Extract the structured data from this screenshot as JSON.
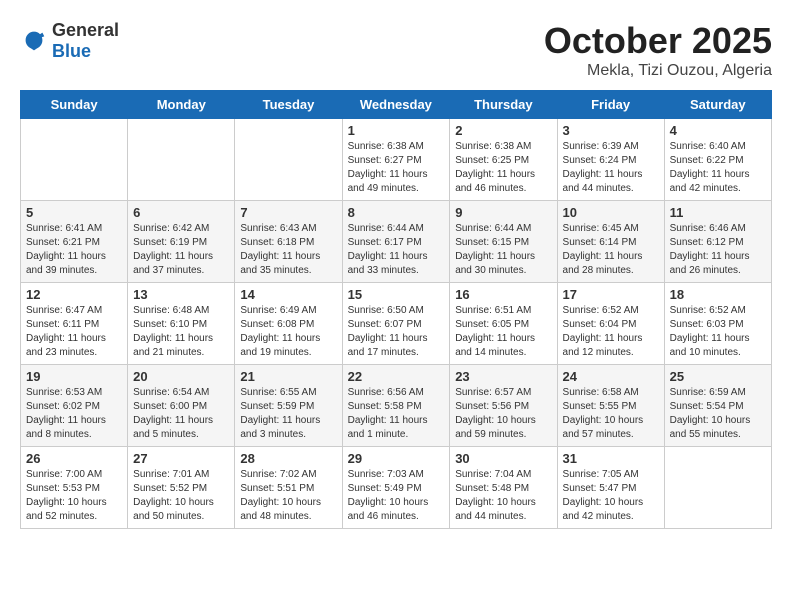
{
  "header": {
    "logo_general": "General",
    "logo_blue": "Blue",
    "month_title": "October 2025",
    "location": "Mekla, Tizi Ouzou, Algeria"
  },
  "weekdays": [
    "Sunday",
    "Monday",
    "Tuesday",
    "Wednesday",
    "Thursday",
    "Friday",
    "Saturday"
  ],
  "weeks": [
    [
      {
        "day": "",
        "detail": ""
      },
      {
        "day": "",
        "detail": ""
      },
      {
        "day": "",
        "detail": ""
      },
      {
        "day": "1",
        "detail": "Sunrise: 6:38 AM\nSunset: 6:27 PM\nDaylight: 11 hours\nand 49 minutes."
      },
      {
        "day": "2",
        "detail": "Sunrise: 6:38 AM\nSunset: 6:25 PM\nDaylight: 11 hours\nand 46 minutes."
      },
      {
        "day": "3",
        "detail": "Sunrise: 6:39 AM\nSunset: 6:24 PM\nDaylight: 11 hours\nand 44 minutes."
      },
      {
        "day": "4",
        "detail": "Sunrise: 6:40 AM\nSunset: 6:22 PM\nDaylight: 11 hours\nand 42 minutes."
      }
    ],
    [
      {
        "day": "5",
        "detail": "Sunrise: 6:41 AM\nSunset: 6:21 PM\nDaylight: 11 hours\nand 39 minutes."
      },
      {
        "day": "6",
        "detail": "Sunrise: 6:42 AM\nSunset: 6:19 PM\nDaylight: 11 hours\nand 37 minutes."
      },
      {
        "day": "7",
        "detail": "Sunrise: 6:43 AM\nSunset: 6:18 PM\nDaylight: 11 hours\nand 35 minutes."
      },
      {
        "day": "8",
        "detail": "Sunrise: 6:44 AM\nSunset: 6:17 PM\nDaylight: 11 hours\nand 33 minutes."
      },
      {
        "day": "9",
        "detail": "Sunrise: 6:44 AM\nSunset: 6:15 PM\nDaylight: 11 hours\nand 30 minutes."
      },
      {
        "day": "10",
        "detail": "Sunrise: 6:45 AM\nSunset: 6:14 PM\nDaylight: 11 hours\nand 28 minutes."
      },
      {
        "day": "11",
        "detail": "Sunrise: 6:46 AM\nSunset: 6:12 PM\nDaylight: 11 hours\nand 26 minutes."
      }
    ],
    [
      {
        "day": "12",
        "detail": "Sunrise: 6:47 AM\nSunset: 6:11 PM\nDaylight: 11 hours\nand 23 minutes."
      },
      {
        "day": "13",
        "detail": "Sunrise: 6:48 AM\nSunset: 6:10 PM\nDaylight: 11 hours\nand 21 minutes."
      },
      {
        "day": "14",
        "detail": "Sunrise: 6:49 AM\nSunset: 6:08 PM\nDaylight: 11 hours\nand 19 minutes."
      },
      {
        "day": "15",
        "detail": "Sunrise: 6:50 AM\nSunset: 6:07 PM\nDaylight: 11 hours\nand 17 minutes."
      },
      {
        "day": "16",
        "detail": "Sunrise: 6:51 AM\nSunset: 6:05 PM\nDaylight: 11 hours\nand 14 minutes."
      },
      {
        "day": "17",
        "detail": "Sunrise: 6:52 AM\nSunset: 6:04 PM\nDaylight: 11 hours\nand 12 minutes."
      },
      {
        "day": "18",
        "detail": "Sunrise: 6:52 AM\nSunset: 6:03 PM\nDaylight: 11 hours\nand 10 minutes."
      }
    ],
    [
      {
        "day": "19",
        "detail": "Sunrise: 6:53 AM\nSunset: 6:02 PM\nDaylight: 11 hours\nand 8 minutes."
      },
      {
        "day": "20",
        "detail": "Sunrise: 6:54 AM\nSunset: 6:00 PM\nDaylight: 11 hours\nand 5 minutes."
      },
      {
        "day": "21",
        "detail": "Sunrise: 6:55 AM\nSunset: 5:59 PM\nDaylight: 11 hours\nand 3 minutes."
      },
      {
        "day": "22",
        "detail": "Sunrise: 6:56 AM\nSunset: 5:58 PM\nDaylight: 11 hours\nand 1 minute."
      },
      {
        "day": "23",
        "detail": "Sunrise: 6:57 AM\nSunset: 5:56 PM\nDaylight: 10 hours\nand 59 minutes."
      },
      {
        "day": "24",
        "detail": "Sunrise: 6:58 AM\nSunset: 5:55 PM\nDaylight: 10 hours\nand 57 minutes."
      },
      {
        "day": "25",
        "detail": "Sunrise: 6:59 AM\nSunset: 5:54 PM\nDaylight: 10 hours\nand 55 minutes."
      }
    ],
    [
      {
        "day": "26",
        "detail": "Sunrise: 7:00 AM\nSunset: 5:53 PM\nDaylight: 10 hours\nand 52 minutes."
      },
      {
        "day": "27",
        "detail": "Sunrise: 7:01 AM\nSunset: 5:52 PM\nDaylight: 10 hours\nand 50 minutes."
      },
      {
        "day": "28",
        "detail": "Sunrise: 7:02 AM\nSunset: 5:51 PM\nDaylight: 10 hours\nand 48 minutes."
      },
      {
        "day": "29",
        "detail": "Sunrise: 7:03 AM\nSunset: 5:49 PM\nDaylight: 10 hours\nand 46 minutes."
      },
      {
        "day": "30",
        "detail": "Sunrise: 7:04 AM\nSunset: 5:48 PM\nDaylight: 10 hours\nand 44 minutes."
      },
      {
        "day": "31",
        "detail": "Sunrise: 7:05 AM\nSunset: 5:47 PM\nDaylight: 10 hours\nand 42 minutes."
      },
      {
        "day": "",
        "detail": ""
      }
    ]
  ]
}
